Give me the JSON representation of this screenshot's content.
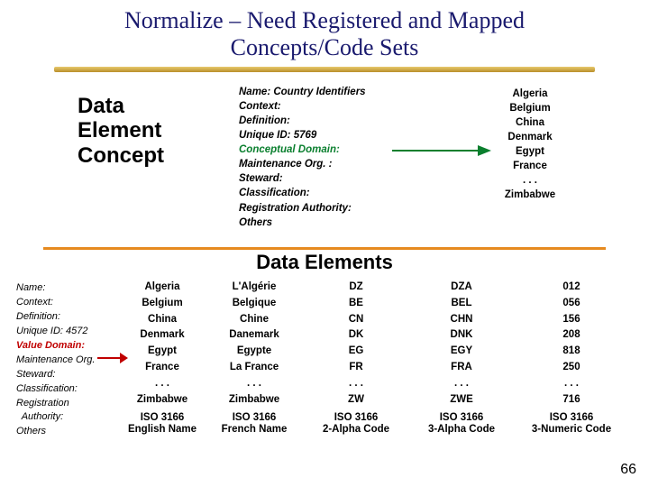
{
  "title_line1": "Normalize – Need Registered and Mapped",
  "title_line2": "Concepts/Code Sets",
  "dec_label_l1": "Data",
  "dec_label_l2": "Element",
  "dec_label_l3": "Concept",
  "dec_fields": {
    "f1": "Name: Country Identifiers",
    "f2": "Context:",
    "f3": "Definition:",
    "f4": "Unique ID: 5769",
    "f5": "Conceptual Domain:",
    "f6": "Maintenance Org. :",
    "f7": "Steward:",
    "f8": "Classification:",
    "f9": "Registration Authority:",
    "f10": "Others"
  },
  "country_list": [
    "Algeria",
    "Belgium",
    "China",
    "Denmark",
    "Egypt",
    "France",
    ". . .",
    "Zimbabwe"
  ],
  "data_elements_heading": "Data Elements",
  "left_fields": {
    "f1": "Name:",
    "f2": "Context:",
    "f3": "Definition:",
    "f4": "Unique ID: 4572",
    "f5": "Value Domain:",
    "f6": "Maintenance Org.",
    "f7": "Steward:",
    "f8": "Classification:",
    "f9": "Registration",
    "f9b": "  Authority:",
    "f10": "Others"
  },
  "columns": [
    {
      "rows": [
        "Algeria",
        "Belgium",
        "China",
        "Denmark",
        "Egypt",
        "France",
        ". . .",
        "Zimbabwe"
      ],
      "foot1": "ISO 3166",
      "foot2": "English Name"
    },
    {
      "rows": [
        "L'Algérie",
        "Belgique",
        "Chine",
        "Danemark",
        "Egypte",
        "La France",
        ". . .",
        "Zimbabwe"
      ],
      "foot1": "ISO 3166",
      "foot2": "French Name"
    },
    {
      "rows": [
        "DZ",
        "BE",
        "CN",
        "DK",
        "EG",
        "FR",
        ". . .",
        "ZW"
      ],
      "foot1": "ISO 3166",
      "foot2": "2-Alpha Code"
    },
    {
      "rows": [
        "DZA",
        "BEL",
        "CHN",
        "DNK",
        "EGY",
        "FRA",
        ". . .",
        "ZWE"
      ],
      "foot1": "ISO 3166",
      "foot2": "3-Alpha Code"
    },
    {
      "rows": [
        "012",
        "056",
        "156",
        "208",
        "818",
        "250",
        ". . .",
        "716"
      ],
      "foot1": "ISO 3166",
      "foot2": "3-Numeric Code"
    }
  ],
  "page_number": "66",
  "chart_data": {
    "type": "table",
    "title": "Data Elements — ISO 3166 Country Codes",
    "column_headers": [
      "ISO 3166 English Name",
      "ISO 3166 French Name",
      "ISO 3166 2-Alpha Code",
      "ISO 3166 3-Alpha Code",
      "ISO 3166 3-Numeric Code"
    ],
    "rows": [
      [
        "Algeria",
        "L'Algérie",
        "DZ",
        "DZA",
        "012"
      ],
      [
        "Belgium",
        "Belgique",
        "BE",
        "BEL",
        "056"
      ],
      [
        "China",
        "Chine",
        "CN",
        "CHN",
        "156"
      ],
      [
        "Denmark",
        "Danemark",
        "DK",
        "DNK",
        "208"
      ],
      [
        "Egypt",
        "Egypte",
        "EG",
        "EGY",
        "818"
      ],
      [
        "France",
        "La France",
        "FR",
        "FRA",
        "250"
      ],
      [
        ". . .",
        ". . .",
        ". . .",
        ". . .",
        ". . ."
      ],
      [
        "Zimbabwe",
        "Zimbabwe",
        "ZW",
        "ZWE",
        "716"
      ]
    ]
  }
}
